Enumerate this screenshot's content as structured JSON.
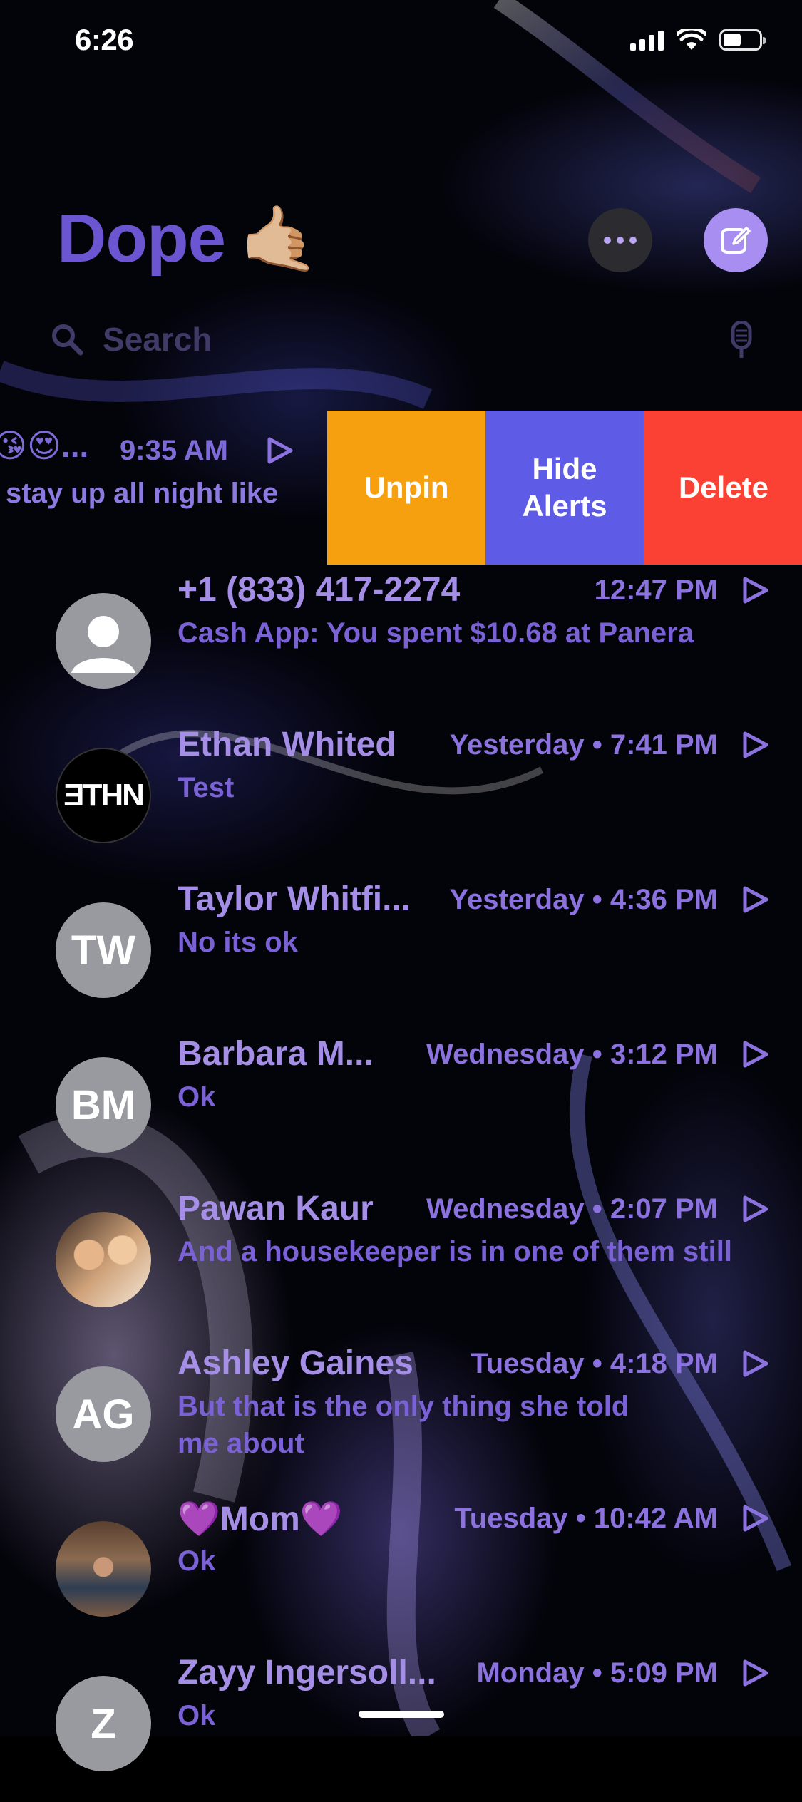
{
  "status_bar": {
    "time": "6:26"
  },
  "header": {
    "title": "Dope",
    "title_emoji": "🤙🏼"
  },
  "search": {
    "placeholder": "Search"
  },
  "pinned_row": {
    "emojis": "😘😍...",
    "time": "9:35 AM",
    "preview": "stay up all night like"
  },
  "swipe_actions": {
    "unpin": "Unpin",
    "hide_alerts_line1": "Hide",
    "hide_alerts_line2": "Alerts",
    "delete": "Delete"
  },
  "conversations": [
    {
      "name": "+1 (833) 417-2274",
      "time": "12:47 PM",
      "preview": "Cash App: You spent $10.68 at Panera",
      "avatar": "person-icon"
    },
    {
      "name": "Ethan Whited",
      "time": "Yesterday • 7:41 PM",
      "preview": "Test",
      "avatar_text": "ƎTHN"
    },
    {
      "name": "Taylor Whitfi...",
      "time": "Yesterday • 4:36 PM",
      "preview": "No its ok",
      "avatar_text": "TW"
    },
    {
      "name": "Barbara M...",
      "time": "Wednesday • 3:12 PM",
      "preview": "Ok",
      "avatar_text": "BM"
    },
    {
      "name": "Pawan Kaur",
      "time": "Wednesday • 2:07 PM",
      "preview": "And a housekeeper is in one of them still",
      "avatar": "photo"
    },
    {
      "name": "Ashley Gaines",
      "time": "Tuesday • 4:18 PM",
      "preview": "But that is the only thing she told me about",
      "avatar_text": "AG"
    },
    {
      "name": "💜Mom💜",
      "time": "Tuesday • 10:42 AM",
      "preview": "Ok",
      "avatar": "photo"
    },
    {
      "name": "Zayy Ingersoll...",
      "time": "Monday • 5:09 PM",
      "preview": "Ok",
      "avatar_text": "Z"
    }
  ],
  "colors": {
    "accent": "#6b55d0",
    "unpin": "#f7a00f",
    "hide_alerts": "#5e5ce6",
    "delete": "#fb4133",
    "name": "#a58ee6"
  }
}
